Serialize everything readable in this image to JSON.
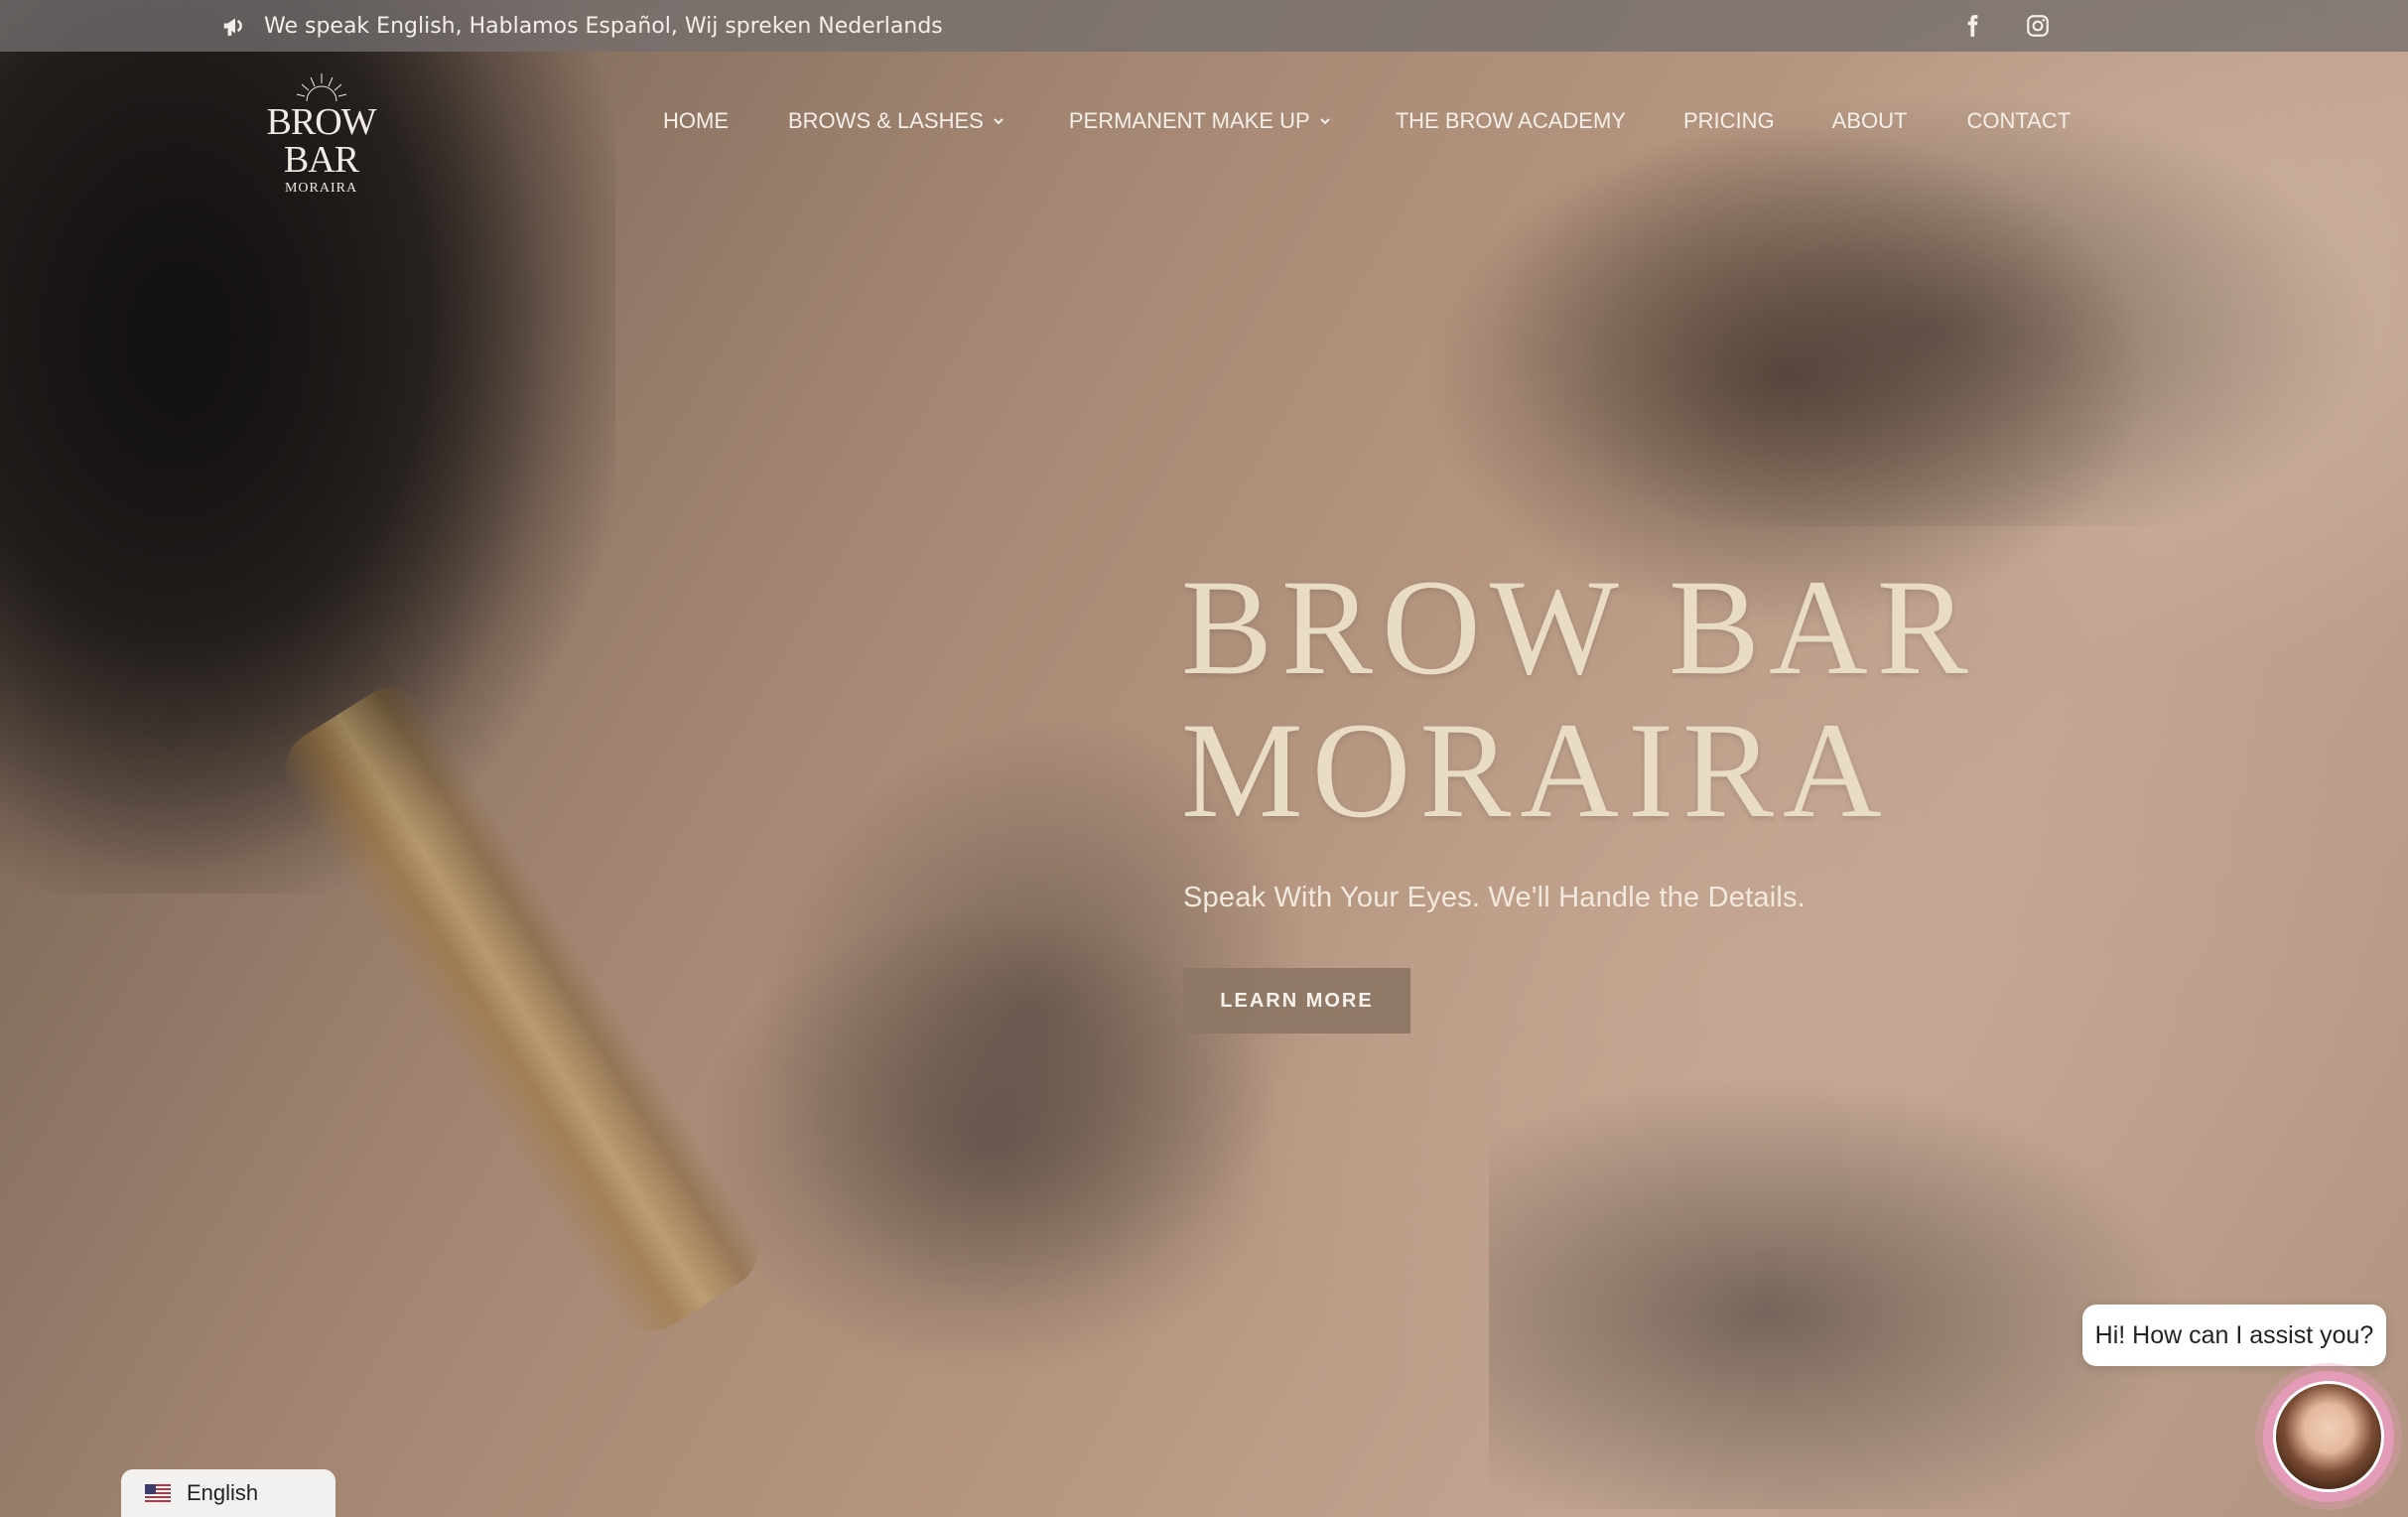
{
  "topbar": {
    "announcement": "We speak English, Hablamos Español, Wij spreken Nederlands",
    "announcement_icon": "megaphone-icon",
    "social": [
      "facebook-icon",
      "instagram-icon"
    ]
  },
  "logo": {
    "brand": "BROW BAR",
    "sub": "MORAIRA"
  },
  "nav": {
    "items": [
      {
        "label": "HOME",
        "dropdown": false
      },
      {
        "label": "BROWS & LASHES",
        "dropdown": true
      },
      {
        "label": "PERMANENT MAKE UP",
        "dropdown": true
      },
      {
        "label": "THE BROW ACADEMY",
        "dropdown": false
      },
      {
        "label": "PRICING",
        "dropdown": false
      },
      {
        "label": "ABOUT",
        "dropdown": false
      },
      {
        "label": "CONTACT",
        "dropdown": false
      }
    ]
  },
  "hero": {
    "title_line1": "BROW BAR",
    "title_line2": "MORAIRA",
    "subtitle": "Speak With Your Eyes. We'll Handle the Details.",
    "cta": "LEARN MORE"
  },
  "language": {
    "current": "English",
    "flag_icon": "us-flag-icon"
  },
  "chat": {
    "greeting": "Hi! How can I assist you?"
  },
  "colors": {
    "topbar_bg": "#736e6e",
    "title": "#e9dcc5",
    "cta_bg": "#8c7664",
    "chat_ring": "#e49bb8"
  }
}
